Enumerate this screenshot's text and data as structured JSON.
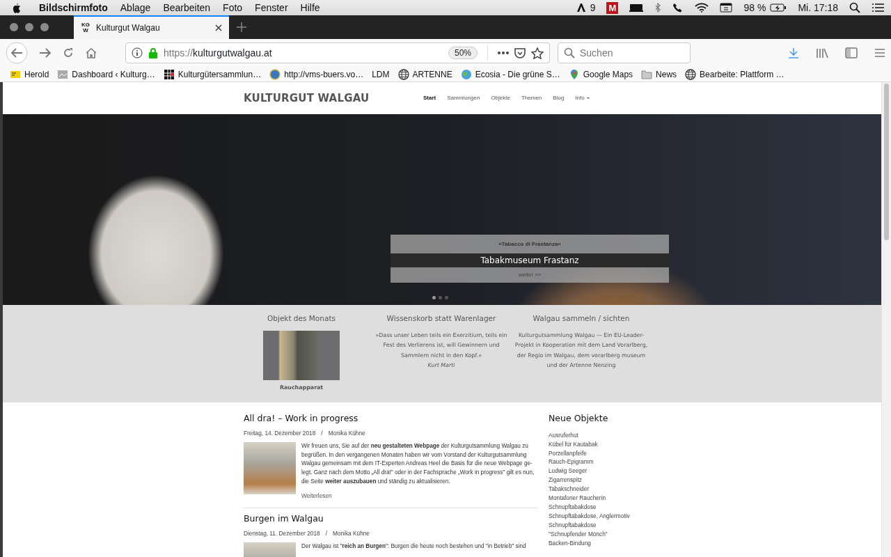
{
  "menubar": {
    "app": "Bildschirmfoto",
    "menus": [
      "Ablage",
      "Bearbeiten",
      "Foto",
      "Fenster",
      "Hilfe"
    ],
    "adobe_count": "9",
    "app_letter": "M",
    "battery": "98 %",
    "clock": "Mi. 17:18"
  },
  "browser": {
    "tabs": [
      {
        "title": "Kulturgut Walgau",
        "favicon": [
          "KG",
          "W"
        ],
        "selected": true
      }
    ],
    "url_scheme": "https://",
    "url_host": "kulturgutwalgau.at",
    "zoom": "50%",
    "search_placeholder": "Suchen",
    "bookmarks": [
      {
        "label": "Herold",
        "kind": "flag"
      },
      {
        "label": "Dashboard ‹ Kulturg…",
        "kind": "thumb"
      },
      {
        "label": "Kulturgütersammlun…",
        "kind": "grid"
      },
      {
        "label": "http://vms-buers.vo…",
        "kind": "seal"
      },
      {
        "label": "LDM",
        "kind": "none"
      },
      {
        "label": "ARTENNE",
        "kind": "globe"
      },
      {
        "label": "Ecosia - Die grüne S…",
        "kind": "earth"
      },
      {
        "label": "Google Maps",
        "kind": "maps"
      },
      {
        "label": "News",
        "kind": "folder"
      },
      {
        "label": "Bearbeite: Plattform …",
        "kind": "globe"
      }
    ]
  },
  "site": {
    "brand": "KULTURGUT WALGAU",
    "nav": [
      {
        "label": "Start",
        "selected": true,
        "dropdown": false
      },
      {
        "label": "Sammlungen",
        "selected": false,
        "dropdown": false
      },
      {
        "label": "Objekte",
        "selected": false,
        "dropdown": false
      },
      {
        "label": "Themen",
        "selected": false,
        "dropdown": false
      },
      {
        "label": "Blog",
        "selected": false,
        "dropdown": false
      },
      {
        "label": "Info",
        "selected": false,
        "dropdown": true
      }
    ],
    "hero": {
      "kicker": "»Tabacco di Frastanza«",
      "title": "Tabakmuseum Frastanz",
      "link": "weiter »»",
      "indicators": [
        {
          "selected": true
        },
        {
          "selected": false
        },
        {
          "selected": false
        }
      ]
    },
    "features": [
      {
        "kind": "image",
        "title": "Objekt des Monats",
        "caption": "Rauchapparat"
      },
      {
        "kind": "quote",
        "title": "Wissenskorb statt Warenlager",
        "text": "»Dass unser Leben teils ein Exerzitium, teils ein Fest des Verlierens ist, will Gewinnern und Sammlern nicht in den Kopf.«",
        "author": "Kurt Marti"
      },
      {
        "kind": "text",
        "title": "Walgau sammeln / sichten",
        "text": "Kulturgutsammlung Walgau — Ein EU-Leader-Projekt in Kooperation mit dem Land Vorarlberg, der Regio im Walgau, dem vorarlberg museum und der Artenne Nenzing"
      }
    ],
    "posts": [
      {
        "title": "All dra! – Work in progress",
        "date": "Freitag, 14. Dezember 2018",
        "separator": "/",
        "author": "Monika Kühne",
        "body": "Wir freuen uns, Sie auf der **neu gestalteten Webpage** der Kulturgutsammlung Walgau zu begrüßen. In den vergangenen Monaten haben wir vom Vorstand der Kulturgutsammlung Walgau gemeinsam mit dem IT-Experten Andreas Heel die Basis für die neue Webpage ge-legt. Ganz nach dem Motto „All dra!\" oder in der Fachsprache „Work in progress\" gilt es nun, die Seite **weiter auszubauen** und ständig zu aktualisieren.",
        "more": "Weiterlesen"
      },
      {
        "title": "Burgen im Walgau",
        "date": "Dienstag, 11. Dezember 2018",
        "separator": "/",
        "author": "Monika Kühne",
        "body": "Der Walgau ist \"**reich an Burgen**\": Burgen die heute noch bestehen und \"in Betrieb\" sind"
      }
    ],
    "sidebar": {
      "title": "Neue Objekte",
      "items": [
        "Ausruferhut",
        "Kübel für Kautabak",
        "Porzellanpfeife",
        "Rauch-Epigramm",
        "Ludwig Seeger",
        "Zigarrenspitz",
        "Tabakschneider",
        "Montafoner Raucherin",
        "Schnupftabakdose",
        "Schnupftabakdose, Anglermotiv",
        "Schnupftabakdose",
        "\"Schnupfender Mönch\"",
        "Backen-Bindung"
      ]
    }
  }
}
